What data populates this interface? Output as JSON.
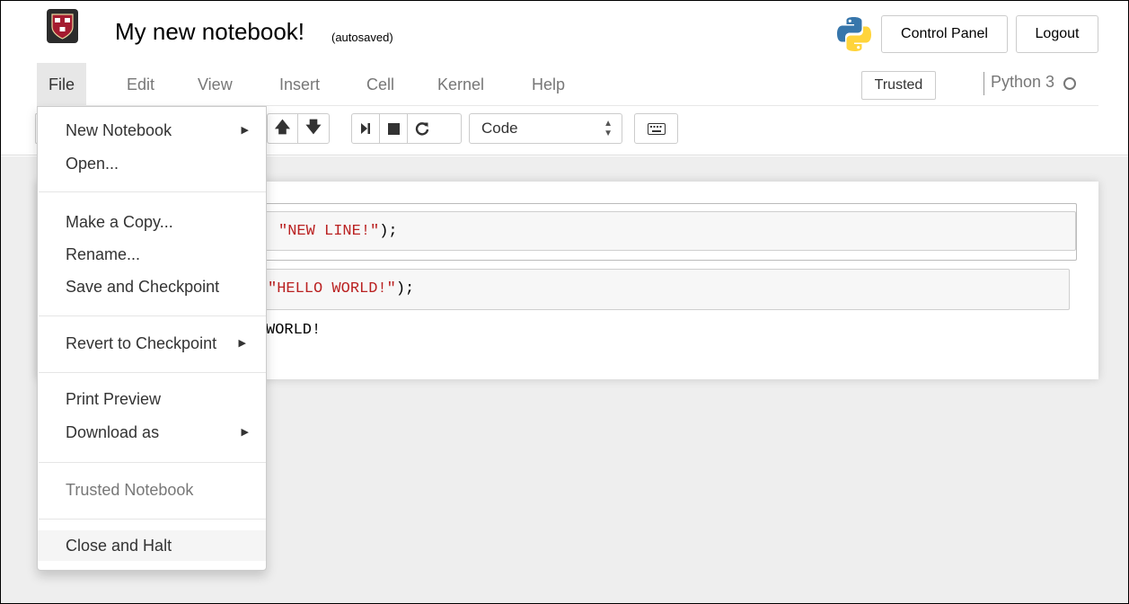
{
  "header": {
    "title": "My new notebook!",
    "autosave_status": "(autosaved)",
    "control_panel_label": "Control Panel",
    "logout_label": "Logout"
  },
  "menubar": {
    "items": [
      "File",
      "Edit",
      "View",
      "Insert",
      "Cell",
      "Kernel",
      "Help"
    ],
    "trusted_label": "Trusted",
    "kernel_name": "Python 3"
  },
  "toolbar": {
    "cell_type": "Code"
  },
  "cells": [
    {
      "code_string": "\"NEW LINE!\"",
      "code_punct": ");"
    },
    {
      "code_string": "\"HELLO WORLD!\"",
      "code_punct": ");",
      "output": "WORLD!"
    }
  ],
  "file_menu": {
    "new_notebook": "New Notebook",
    "open": "Open...",
    "make_copy": "Make a Copy...",
    "rename": "Rename...",
    "save_checkpoint": "Save and Checkpoint",
    "revert_checkpoint": "Revert to Checkpoint",
    "print_preview": "Print Preview",
    "download_as": "Download as",
    "trusted_notebook": "Trusted Notebook",
    "close_halt": "Close and Halt"
  }
}
